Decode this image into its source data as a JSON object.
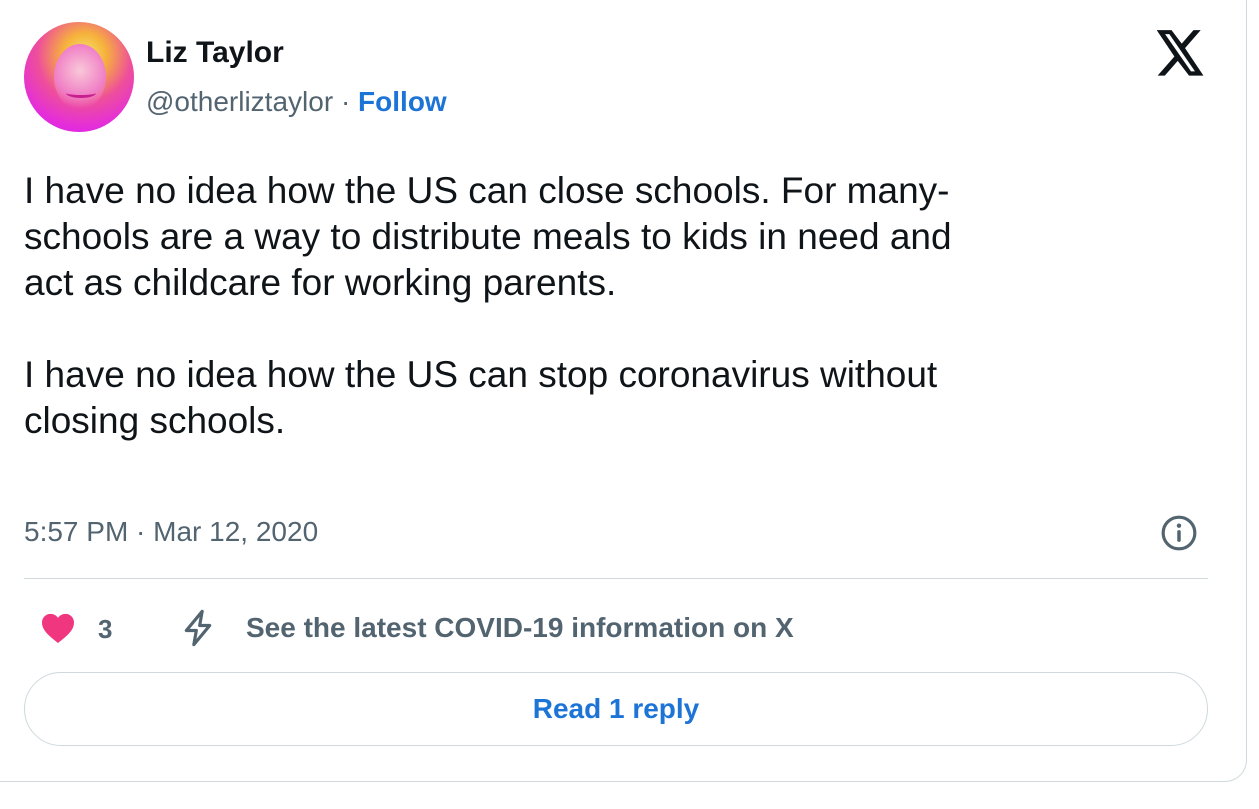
{
  "author": {
    "name": "Liz Taylor",
    "handle": "@otherliztaylor",
    "separator": "·",
    "follow_label": "Follow"
  },
  "tweet": {
    "text": "I have no idea how the US can close schools. For many-\nschools are a way to distribute meals to kids in need and\nact as childcare for working parents.\n\nI have no idea how the US can stop coronavirus without\nclosing schools.",
    "timestamp": "5:57 PM · Mar 12, 2020"
  },
  "actions": {
    "like_count": "3",
    "covid_link": "See the latest COVID-19 information on X"
  },
  "reply_button": {
    "label": "Read 1 reply"
  },
  "icons": {
    "platform_logo": "x-logo-icon",
    "info": "info-icon",
    "like": "heart-icon",
    "covid": "lightning-bolt-icon"
  },
  "colors": {
    "accent": "#1d74d7",
    "like": "#f0367e",
    "muted_text": "#536471",
    "border": "#cfd9de"
  }
}
